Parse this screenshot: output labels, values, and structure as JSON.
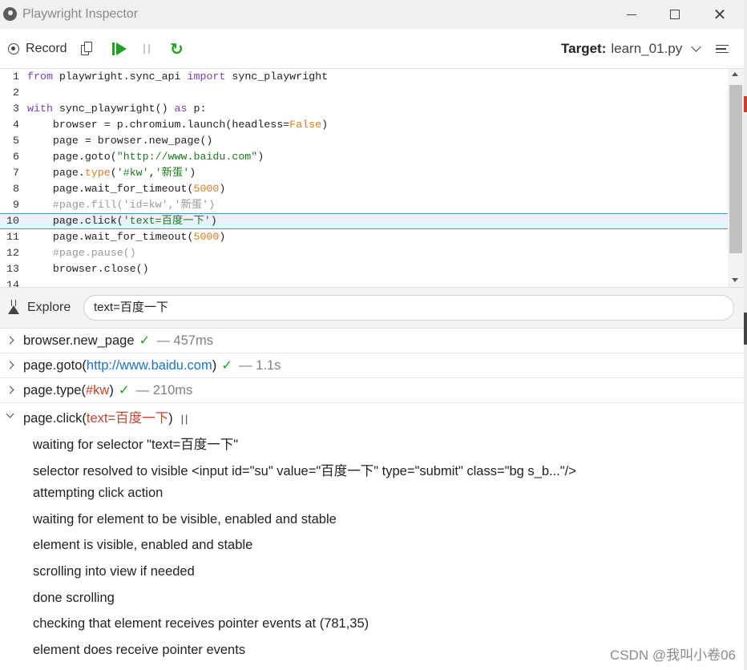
{
  "window": {
    "title": "Playwright Inspector"
  },
  "toolbar": {
    "record_label": "Record",
    "target_label": "Target:",
    "target_value": "learn_01.py"
  },
  "editor": {
    "lines": [
      {
        "n": "1",
        "tokens": [
          {
            "t": "from",
            "c": "kw"
          },
          {
            "t": " playwright.sync_api ",
            "c": ""
          },
          {
            "t": "import",
            "c": "kw"
          },
          {
            "t": " sync_playwright",
            "c": ""
          }
        ]
      },
      {
        "n": "2",
        "tokens": []
      },
      {
        "n": "3",
        "tokens": [
          {
            "t": "with",
            "c": "kw"
          },
          {
            "t": " sync_playwright() ",
            "c": ""
          },
          {
            "t": "as",
            "c": "kw"
          },
          {
            "t": " p:",
            "c": ""
          }
        ]
      },
      {
        "n": "4",
        "tokens": [
          {
            "t": "    browser = p.chromium.launch(headless=",
            "c": ""
          },
          {
            "t": "False",
            "c": "attr"
          },
          {
            "t": ")",
            "c": ""
          }
        ]
      },
      {
        "n": "5",
        "tokens": [
          {
            "t": "    page = browser.new_page()",
            "c": ""
          }
        ]
      },
      {
        "n": "6",
        "tokens": [
          {
            "t": "    page.goto(",
            "c": ""
          },
          {
            "t": "\"http://www.baidu.com\"",
            "c": "str"
          },
          {
            "t": ")",
            "c": ""
          }
        ]
      },
      {
        "n": "7",
        "tokens": [
          {
            "t": "    page.",
            "c": ""
          },
          {
            "t": "type",
            "c": "attr"
          },
          {
            "t": "(",
            "c": ""
          },
          {
            "t": "'#kw'",
            "c": "str"
          },
          {
            "t": ",",
            "c": ""
          },
          {
            "t": "'新蛋'",
            "c": "str"
          },
          {
            "t": ")",
            "c": ""
          }
        ]
      },
      {
        "n": "8",
        "tokens": [
          {
            "t": "    page.wait_for_timeout(",
            "c": ""
          },
          {
            "t": "5000",
            "c": "num"
          },
          {
            "t": ")",
            "c": ""
          }
        ]
      },
      {
        "n": "9",
        "tokens": [
          {
            "t": "    #page.fill('id=kw','新蛋')",
            "c": "cmt"
          }
        ]
      },
      {
        "n": "10",
        "active": true,
        "tokens": [
          {
            "t": "    page.click(",
            "c": ""
          },
          {
            "t": "'text=百度一下'",
            "c": "str"
          },
          {
            "t": ")",
            "c": ""
          }
        ]
      },
      {
        "n": "11",
        "tokens": [
          {
            "t": "    page.wait_for_timeout(",
            "c": ""
          },
          {
            "t": "5000",
            "c": "num"
          },
          {
            "t": ")",
            "c": ""
          }
        ]
      },
      {
        "n": "12",
        "tokens": [
          {
            "t": "    #page.pause()",
            "c": "cmt"
          }
        ]
      },
      {
        "n": "13",
        "tokens": [
          {
            "t": "    browser.close()",
            "c": ""
          }
        ]
      },
      {
        "n": "14",
        "tokens": []
      }
    ]
  },
  "explore": {
    "label": "Explore",
    "value": "text=百度一下"
  },
  "log": {
    "entries": [
      {
        "name": "browser.new_page",
        "arg": "",
        "arg_kind": "",
        "status": "✓",
        "duration": "— 457ms"
      },
      {
        "name": "page.goto(",
        "arg": "http://www.baidu.com",
        "arg_kind": "link",
        "close": ")",
        "status": "✓",
        "duration": "— 1.1s"
      },
      {
        "name": "page.type(",
        "arg": "#kw",
        "arg_kind": "sel",
        "close": ")",
        "status": "✓",
        "duration": "— 210ms"
      },
      {
        "name": "page.click(",
        "arg": "text=百度一下",
        "arg_kind": "sel",
        "close": ")",
        "status": "paused",
        "duration": ""
      }
    ],
    "details": [
      "waiting for selector \"text=百度一下\"",
      "selector resolved to visible <input id=\"su\" value=\"百度一下\" type=\"submit\" class=\"bg s_b...\"/>",
      "attempting click action",
      "waiting for element to be visible, enabled and stable",
      "element is visible, enabled and stable",
      "scrolling into view if needed",
      "done scrolling",
      "checking that element receives pointer events at (781,35)",
      "element does receive pointer events"
    ]
  },
  "watermark": "CSDN @我叫小卷06",
  "colors": {
    "accent_green": "#1fa11f",
    "link_blue": "#1a73c8",
    "selector_red": "#c8432b"
  }
}
